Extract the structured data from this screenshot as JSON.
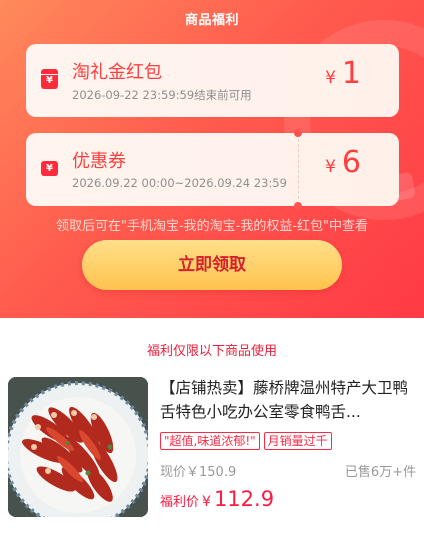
{
  "header": {
    "title": "商品福利"
  },
  "hongbao": {
    "name": "淘礼金红包",
    "time": "2026-09-22 23:59:59结束前可用",
    "currency": "¥",
    "amount": "1",
    "icon": "red-envelope-icon"
  },
  "coupon": {
    "name": "优惠券",
    "time": "2026.09.22 00:00~2026.09.24 23:59",
    "currency": "¥",
    "amount": "6",
    "icon": "ticket-icon"
  },
  "hint": "领取后可在\"手机淘宝-我的淘宝-我的权益-红包\"中查看",
  "claim_button": "立即领取",
  "limit_note": "福利仅限以下商品使用",
  "product": {
    "title": "【店铺热卖】藤桥牌温州特产大卫鸭舌特色小吃办公室零食鸭舌...",
    "tags": [
      "\"超值,味道浓郁!\"",
      "月销量过千"
    ],
    "price_now": "现价￥150.9",
    "sold": "已售6万+件",
    "welfare_label": "福利价",
    "welfare_currency": "¥",
    "welfare_price": "112.9"
  },
  "colors": {
    "accent_red": "#ff3f3f",
    "button_yellow": "#ffc24e",
    "price_red": "#ff1a40"
  }
}
